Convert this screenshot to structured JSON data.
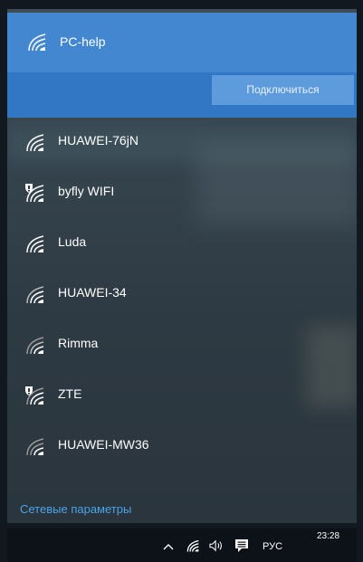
{
  "networks": {
    "selected": {
      "name": "PC-help",
      "connect_label": "Подключиться",
      "icon": "wifi-icon"
    },
    "items": [
      {
        "name": "HUAWEI-76jN",
        "icon": "wifi-icon",
        "secured": true
      },
      {
        "name": "byfly WIFI",
        "icon": "wifi-open-shield-icon",
        "secured": false
      },
      {
        "name": "Luda",
        "icon": "wifi-icon",
        "secured": true
      },
      {
        "name": "HUAWEI-34",
        "icon": "wifi-icon",
        "secured": true
      },
      {
        "name": "Rimma",
        "icon": "wifi-icon",
        "secured": true
      },
      {
        "name": "ZTE",
        "icon": "wifi-open-shield-icon",
        "secured": false
      },
      {
        "name": "HUAWEI-MW36",
        "icon": "wifi-icon",
        "secured": true
      }
    ]
  },
  "settings_link": "Сетевые параметры",
  "taskbar": {
    "language": "РУС",
    "time": "23:28",
    "icons": [
      "chevron-up-icon",
      "wifi-icon",
      "volume-icon",
      "notification-icon"
    ]
  },
  "colors": {
    "accent": "#4287d0",
    "accent_dark": "#3277c3",
    "button": "#5d9bdc",
    "link": "#4aa3e8",
    "taskbar": "#0d1218"
  }
}
